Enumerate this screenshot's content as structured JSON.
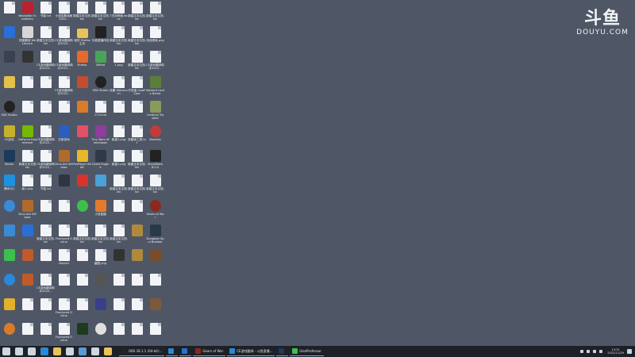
{
  "watermark": {
    "main": "斗鱼",
    "sub": "DOUYU.COM"
  },
  "icons": [
    {
      "label": "",
      "type": "doc"
    },
    {
      "label": "Navigator fundamen",
      "type": "app",
      "color": "#b8232f"
    },
    {
      "label": "节能.txt",
      "type": "doc"
    },
    {
      "label": "小说如斯迷局2022...",
      "type": "doc"
    },
    {
      "label": "新建文本文档.txt",
      "type": "doc"
    },
    {
      "label": "新建文本文档.txt",
      "type": "doc"
    },
    {
      "label": "7天训练营.docx",
      "type": "doc"
    },
    {
      "label": "新建文本文档.txt",
      "type": "doc"
    },
    {
      "label": "新建文本文档.txt",
      "type": "doc"
    },
    {
      "label": "",
      "type": "app",
      "color": "#2a6fd6"
    },
    {
      "label": "快速翻译 WeLaunch",
      "type": "app",
      "color": "#d6d6d6"
    },
    {
      "label": "新建文本文档.txt",
      "type": "doc"
    },
    {
      "label": "CE游戏翻译助手2022...",
      "type": "doc"
    },
    {
      "label": "我的 Firefox 主页",
      "type": "folder"
    },
    {
      "label": "抖音直播伴侣",
      "type": "app",
      "color": "#222"
    },
    {
      "label": "新建文本文档.txt",
      "type": "doc"
    },
    {
      "label": "新建文本文档.txt",
      "type": "doc"
    },
    {
      "label": "电池损耗.png",
      "type": "doc"
    },
    {
      "label": "",
      "type": "app",
      "color": "#3a4250"
    },
    {
      "label": "",
      "type": "app",
      "color": "#333"
    },
    {
      "label": "CE游戏翻译助手2022...",
      "type": "doc"
    },
    {
      "label": "CE游戏翻译助手2022...",
      "type": "doc"
    },
    {
      "label": "Firefox",
      "type": "app",
      "color": "#e66a2c"
    },
    {
      "label": "XMind",
      "type": "app",
      "color": "#4aa35a"
    },
    {
      "label": "1.png",
      "type": "doc"
    },
    {
      "label": "新建文本文档.txt",
      "type": "doc"
    },
    {
      "label": "CE游戏翻译助手2022...",
      "type": "doc"
    },
    {
      "label": "",
      "type": "app",
      "color": "#e7c04a"
    },
    {
      "label": "",
      "type": "doc"
    },
    {
      "label": "",
      "type": "doc"
    },
    {
      "label": "CE游戏翻译助手2022...",
      "type": "doc"
    },
    {
      "label": "",
      "type": "app",
      "color": "#c44d2e"
    },
    {
      "label": "OBS Studio",
      "type": "app",
      "color": "#222",
      "round": true
    },
    {
      "label": "设置 WeLaunch",
      "type": "doc"
    },
    {
      "label": "开发者 modFCJoe",
      "type": "doc"
    },
    {
      "label": "Warlord Lords Demo",
      "type": "app",
      "color": "#5b7f3a"
    },
    {
      "label": "OBS Studio",
      "type": "app",
      "color": "#222",
      "round": true
    },
    {
      "label": "",
      "type": "doc"
    },
    {
      "label": "",
      "type": "doc"
    },
    {
      "label": "",
      "type": "doc"
    },
    {
      "label": "",
      "type": "app",
      "color": "#d97c2a"
    },
    {
      "label": "1715.txt",
      "type": "doc"
    },
    {
      "label": "",
      "type": "doc"
    },
    {
      "label": "",
      "type": "doc"
    },
    {
      "label": "Cardinal Traveler",
      "type": "app",
      "color": "#8a9a5b"
    },
    {
      "label": "CE游戏",
      "type": "app",
      "color": "#c6b02b"
    },
    {
      "label": "GeForce Experience",
      "type": "app",
      "color": "#76b900"
    },
    {
      "label": "CE游戏翻译助手2022...",
      "type": "doc"
    },
    {
      "label": "亿家游戏",
      "type": "app",
      "color": "#2b5fbf"
    },
    {
      "label": "",
      "type": "app",
      "color": "#e2506a"
    },
    {
      "label": "Tiny Wars Wreckdown",
      "type": "app",
      "color": "#8e3c9e"
    },
    {
      "label": "新建1.png",
      "type": "doc"
    },
    {
      "label": "多翻译工具.txt",
      "type": "doc"
    },
    {
      "label": "Bonkelo",
      "type": "app",
      "color": "#c23b3b",
      "round": true
    },
    {
      "label": "Steam",
      "type": "app",
      "color": "#1b3a5c"
    },
    {
      "label": "新建文本文档 txt",
      "type": "doc"
    },
    {
      "label": "CE游戏翻译助手2022...",
      "type": "doc"
    },
    {
      "label": "Dino Ant Willows",
      "type": "app",
      "color": "#b06b2a"
    },
    {
      "label": "PotPlayer 64 bit",
      "type": "app",
      "color": "#e8b72b"
    },
    {
      "label": "Cheat Engine",
      "type": "app",
      "color": "#2f3a48"
    },
    {
      "label": "新建1.png",
      "type": "doc"
    },
    {
      "label": "新建文本文档.txt",
      "type": "doc"
    },
    {
      "label": "StoryBlock 8.0.0",
      "type": "app",
      "color": "#222"
    },
    {
      "label": "腾讯QQ",
      "type": "app",
      "color": "#1e90e0"
    },
    {
      "label": "新1.png",
      "type": "doc"
    },
    {
      "label": "节能.txt",
      "type": "doc"
    },
    {
      "label": "",
      "type": "app",
      "color": "#2e3440"
    },
    {
      "label": "",
      "type": "app",
      "color": "#d9342b"
    },
    {
      "label": "",
      "type": "app",
      "color": "#4aa0d8"
    },
    {
      "label": "新建文本文档.txt",
      "type": "doc"
    },
    {
      "label": "新建文本文档.txt",
      "type": "doc"
    },
    {
      "label": "新建文本文档.txt",
      "type": "doc"
    },
    {
      "label": "",
      "type": "app",
      "color": "#3a8ad6",
      "round": true
    },
    {
      "label": "Dino Ant Willows",
      "type": "app",
      "color": "#b06b2a"
    },
    {
      "label": "",
      "type": "doc"
    },
    {
      "label": "",
      "type": "doc"
    },
    {
      "label": "",
      "type": "app",
      "color": "#3dbf4e",
      "round": true
    },
    {
      "label": "小说直播",
      "type": "app",
      "color": "#e27a2f"
    },
    {
      "label": "",
      "type": "doc"
    },
    {
      "label": "",
      "type": "doc"
    },
    {
      "label": "Gears of War",
      "type": "app",
      "color": "#8a2a1e",
      "round": true
    },
    {
      "label": "",
      "type": "app",
      "color": "#3a8ad6"
    },
    {
      "label": "",
      "type": "app",
      "color": "#2a6fd6"
    },
    {
      "label": "新建文本文档.txt",
      "type": "doc"
    },
    {
      "label": "Fractured Online",
      "type": "doc"
    },
    {
      "label": "新建文本文档.txt",
      "type": "doc"
    },
    {
      "label": "新建文本文档.txt",
      "type": "doc"
    },
    {
      "label": "新建文本文档.txt",
      "type": "doc"
    },
    {
      "label": "",
      "type": "app",
      "color": "#b08a3c"
    },
    {
      "label": "Dungeon Soul Breaker",
      "type": "app",
      "color": "#263a4a"
    },
    {
      "label": "",
      "type": "app",
      "color": "#3dbf4e"
    },
    {
      "label": "",
      "type": "app",
      "color": "#c05a2a"
    },
    {
      "label": "",
      "type": "doc"
    },
    {
      "label": "Ubuntu",
      "type": "doc"
    },
    {
      "label": "",
      "type": "doc"
    },
    {
      "label": "截图.png",
      "type": "doc"
    },
    {
      "label": "",
      "type": "app",
      "color": "#333"
    },
    {
      "label": "",
      "type": "app",
      "color": "#b08a3c"
    },
    {
      "label": "",
      "type": "app",
      "color": "#7a4e2a"
    },
    {
      "label": "",
      "type": "app",
      "color": "#2a88d8",
      "round": true
    },
    {
      "label": "",
      "type": "app",
      "color": "#c05a2a"
    },
    {
      "label": "CE游戏翻译助手2022...",
      "type": "doc"
    },
    {
      "label": "",
      "type": "doc"
    },
    {
      "label": "",
      "type": "doc"
    },
    {
      "label": "",
      "type": "app",
      "color": "#555"
    },
    {
      "label": "",
      "type": "doc"
    },
    {
      "label": "",
      "type": "doc"
    },
    {
      "label": "",
      "type": "doc"
    },
    {
      "label": "",
      "type": "app",
      "color": "#e3b02a"
    },
    {
      "label": "",
      "type": "doc"
    },
    {
      "label": "",
      "type": "doc"
    },
    {
      "label": "Fractured Online",
      "type": "doc"
    },
    {
      "label": "",
      "type": "doc"
    },
    {
      "label": "",
      "type": "app",
      "color": "#3a3f8a"
    },
    {
      "label": "",
      "type": "doc"
    },
    {
      "label": "",
      "type": "doc"
    },
    {
      "label": "",
      "type": "app",
      "color": "#7a5a3a"
    },
    {
      "label": "",
      "type": "app",
      "color": "#d97c2a",
      "round": true
    },
    {
      "label": "",
      "type": "doc"
    },
    {
      "label": "",
      "type": "doc"
    },
    {
      "label": "Fractured Online",
      "type": "doc"
    },
    {
      "label": "",
      "type": "app",
      "color": "#1f3a1f"
    },
    {
      "label": "",
      "type": "app",
      "color": "#e0e0e0",
      "round": true
    },
    {
      "label": "",
      "type": "doc"
    },
    {
      "label": "",
      "type": "doc"
    },
    {
      "label": "",
      "type": "doc"
    }
  ],
  "taskbar": {
    "pinned": [
      {
        "name": "start-icon",
        "color": "#cfd6e0"
      },
      {
        "name": "search-icon",
        "color": "#cfd6e0"
      },
      {
        "name": "task-view-icon",
        "color": "#cfd6e0"
      },
      {
        "name": "edge-icon",
        "color": "#2a88d8"
      },
      {
        "name": "explorer-icon",
        "color": "#e9c35a"
      },
      {
        "name": "store-icon",
        "color": "#cfd6e0"
      },
      {
        "name": "mail-icon",
        "color": "#5a9ad8"
      },
      {
        "name": "calculator-icon",
        "color": "#cfd6e0"
      },
      {
        "name": "app-icon",
        "color": "#e9c35a"
      }
    ],
    "apps": [
      {
        "label": "OBS 28.1.1 (64-bit)...",
        "color": "#222"
      },
      {
        "label": "",
        "color": "#2a88d8"
      },
      {
        "label": "",
        "color": "#2a6fd6"
      },
      {
        "label": "Gears of War",
        "color": "#8a2a1e"
      },
      {
        "label": "CE游戏翻译 - 斗鱼直播...",
        "color": "#2a88d8"
      },
      {
        "label": "",
        "color": "#1b3a5c"
      },
      {
        "label": "UiedProfessor",
        "color": "#3dbf4e"
      }
    ],
    "clock": {
      "time": "13:31",
      "date": "2022/11/29"
    }
  }
}
